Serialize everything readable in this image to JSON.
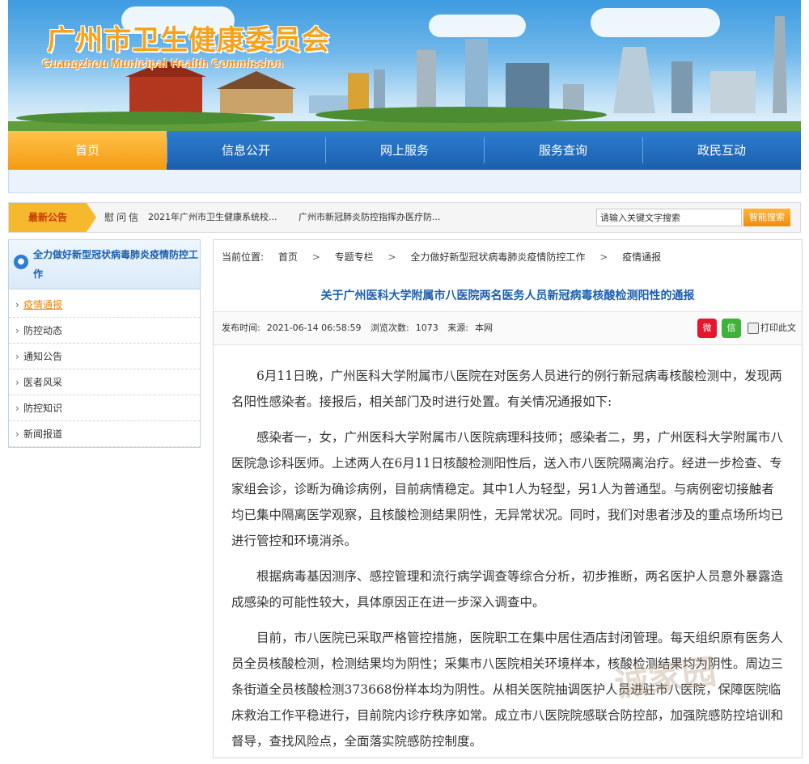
{
  "header": {
    "title_cn": "广州市卫生健康委员会",
    "title_en": "Guangzhou Municipal Health Commission"
  },
  "nav": {
    "items": [
      "首页",
      "信息公开",
      "网上服务",
      "服务查询",
      "政民互动"
    ],
    "active_index": 0
  },
  "notice": {
    "tag": "最新公告",
    "label": "慰问信",
    "links": [
      "2021年广州市卫生健康系统校...",
      "广州市新冠肺炎防控指挥办医疗防..."
    ]
  },
  "search": {
    "placeholder": "请输入关键文字搜索",
    "button": "智能搜索"
  },
  "sidebar": {
    "heading": "全力做好新型冠状病毒肺炎疫情防控工作",
    "items": [
      {
        "label": "疫情通报",
        "active": true
      },
      {
        "label": "防控动态"
      },
      {
        "label": "通知公告"
      },
      {
        "label": "医者风采"
      },
      {
        "label": "防控知识"
      },
      {
        "label": "新闻报道"
      }
    ]
  },
  "breadcrumb": {
    "prefix": "当前位置:",
    "items": [
      "首页",
      "专题专栏",
      "全力做好新型冠状病毒肺炎疫情防控工作",
      "疫情通报"
    ]
  },
  "article": {
    "title": "关于广州医科大学附属市八医院两名医务人员新冠病毒核酸检测阳性的通报",
    "publish_label": "发布时间:",
    "publish_time": "2021-06-14 06:58:59",
    "views_label": "浏览次数:",
    "views": "1073",
    "source_label": "来源:",
    "source": "本网",
    "print_label": "打印此文",
    "paragraphs": [
      "6月11日晚，广州医科大学附属市八医院在对医务人员进行的例行新冠病毒核酸检测中，发现两名阳性感染者。接报后，相关部门及时进行处置。有关情况通报如下:",
      "感染者一，女，广州医科大学附属市八医院病理科技师；感染者二，男，广州医科大学附属市八医院急诊科医师。上述两人在6月11日核酸检测阳性后，送入市八医院隔离治疗。经进一步检查、专家组会诊，诊断为确诊病例，目前病情稳定。其中1人为轻型，另1人为普通型。与病例密切接触者均已集中隔离医学观察，且核酸检测结果阴性，无异常状况。同时，我们对患者涉及的重点场所均已进行管控和环境消杀。",
      "根据病毒基因测序、感控管理和流行病学调查等综合分析，初步推断，两名医护人员意外暴露造成感染的可能性较大，具体原因正在进一步深入调查中。",
      "目前，市八医院已采取严格管控措施，医院职工在集中居住酒店封闭管理。每天组织原有医务人员全员核酸检测，检测结果均为阴性；采集市八医院相关环境样本，核酸检测结果均为阴性。周边三条街道全员核酸检测373668份样本均为阴性。从相关医院抽调医护人员进驻市八医院，保障医院临床救治工作平稳进行，目前院内诊疗秩序如常。成立市八医院院感联合防控部，加强院感防控培训和督导，查找风险点，全面落实院感防控制度。"
    ],
    "share": {
      "weibo": "weibo-icon",
      "wechat": "wechat-icon"
    }
  },
  "watermark": "诚家园"
}
